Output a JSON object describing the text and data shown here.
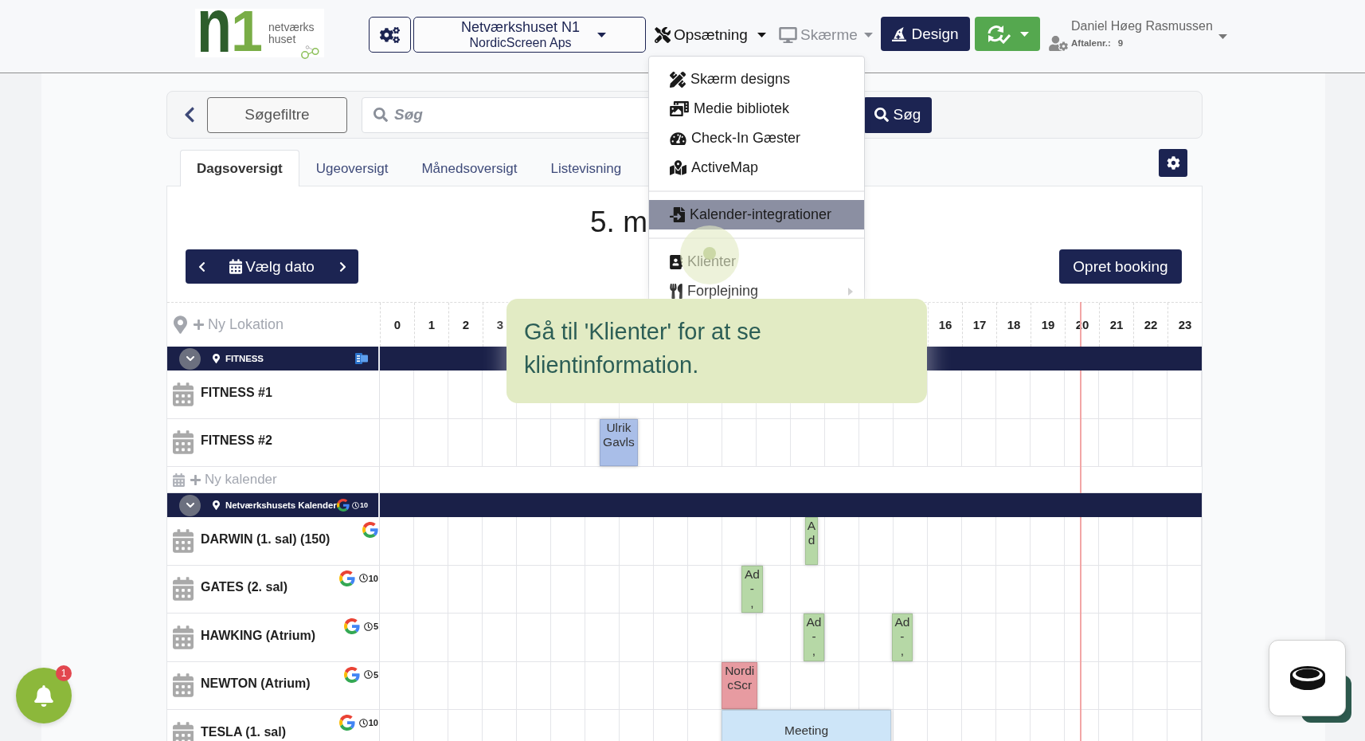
{
  "header": {
    "logo": {
      "letters": [
        "n",
        "1"
      ],
      "name_lines": [
        "netværks",
        "huset"
      ]
    },
    "company": {
      "name": "Netværkshuset N1",
      "subtitle": "NordicScreen Aps"
    },
    "nav": [
      {
        "label": "Opsætning",
        "open": true
      },
      {
        "label": "Skærme",
        "open": false
      }
    ],
    "design_button": "Design",
    "user": {
      "name": "Daniel Høeg Rasmussen",
      "account_label": "Aftalenr.:",
      "account_number": "9"
    }
  },
  "menu": {
    "items": [
      {
        "kind": "item",
        "label": "Skærm designs",
        "highlighted": false,
        "submenu": false
      },
      {
        "kind": "item",
        "label": "Medie bibliotek",
        "highlighted": false,
        "submenu": false
      },
      {
        "kind": "item",
        "label": "Check-In Gæster",
        "highlighted": false,
        "submenu": false
      },
      {
        "kind": "item",
        "label": "ActiveMap",
        "highlighted": false,
        "submenu": false
      },
      {
        "kind": "divider"
      },
      {
        "kind": "item",
        "label": "Kalender-integrationer",
        "highlighted": true,
        "submenu": false
      },
      {
        "kind": "divider"
      },
      {
        "kind": "item",
        "label": "Klienter",
        "highlighted": false,
        "submenu": false
      },
      {
        "kind": "item",
        "label": "Forplejning",
        "highlighted": false,
        "submenu": true
      }
    ]
  },
  "search": {
    "filter_button": "Søgefiltre",
    "placeholder": "Søg",
    "button": "Søg"
  },
  "tabs": [
    {
      "label": "Dagsoversigt",
      "selected": true
    },
    {
      "label": "Ugeoversigt",
      "selected": false
    },
    {
      "label": "Månedsoversigt",
      "selected": false
    },
    {
      "label": "Listevisning",
      "selected": false
    }
  ],
  "calendar": {
    "title": "5. m",
    "date_button": "Vælg dato",
    "create_button": "Opret booking",
    "new_location": "Ny Lokation",
    "hour_labels_start": [
      "0",
      "1",
      "2",
      "3"
    ],
    "hour_labels_end": [
      "16",
      "17",
      "18",
      "19",
      "20",
      "21",
      "22",
      "23"
    ],
    "locations": [
      {
        "name": "FITNESS",
        "expanded": true,
        "kind": "exchange",
        "calendars": [
          {
            "name": "FITNESS #1",
            "kind": "plain"
          },
          {
            "name": "FITNESS #2",
            "kind": "plain",
            "events": [
              {
                "text": "Ulrik Gavls",
                "color": "#a9bee8"
              }
            ]
          }
        ],
        "new_calendar": "Ny kalender"
      },
      {
        "name": "Netværkshusets Kalender",
        "expanded": true,
        "kind": "google",
        "reminder": "10",
        "calendars": [
          {
            "name": "DARWIN (1. sal) (150)",
            "kind": "google",
            "events": [
              {
                "text": "Ad",
                "color": "#b6d8a6"
              }
            ]
          },
          {
            "name": "GATES (2. sal)",
            "kind": "google",
            "reminder": "10",
            "events": [
              {
                "text": "Ad\n-\n,",
                "color": "#b6d8a6"
              }
            ]
          },
          {
            "name": "HAWKING (Atrium)",
            "kind": "google",
            "reminder": "5",
            "events": [
              {
                "text": "Ad\n-\n,",
                "color": "#b6d8a6"
              },
              {
                "text": "Ad\n-\n,",
                "color": "#b6d8a6"
              }
            ]
          },
          {
            "name": "NEWTON (Atrium)",
            "kind": "google",
            "reminder": "5",
            "events": [
              {
                "text": "NordicScr",
                "color": "#e79ba1"
              }
            ]
          },
          {
            "name": "TESLA (1. sal)",
            "kind": "google",
            "reminder": "10",
            "events": [
              {
                "text": "Meeting",
                "color": "#cde5f8"
              }
            ]
          }
        ]
      }
    ]
  },
  "tooltip": {
    "text": "Gå til 'Klienter' for at se klientinformation."
  },
  "notifications": {
    "badge": "1"
  }
}
